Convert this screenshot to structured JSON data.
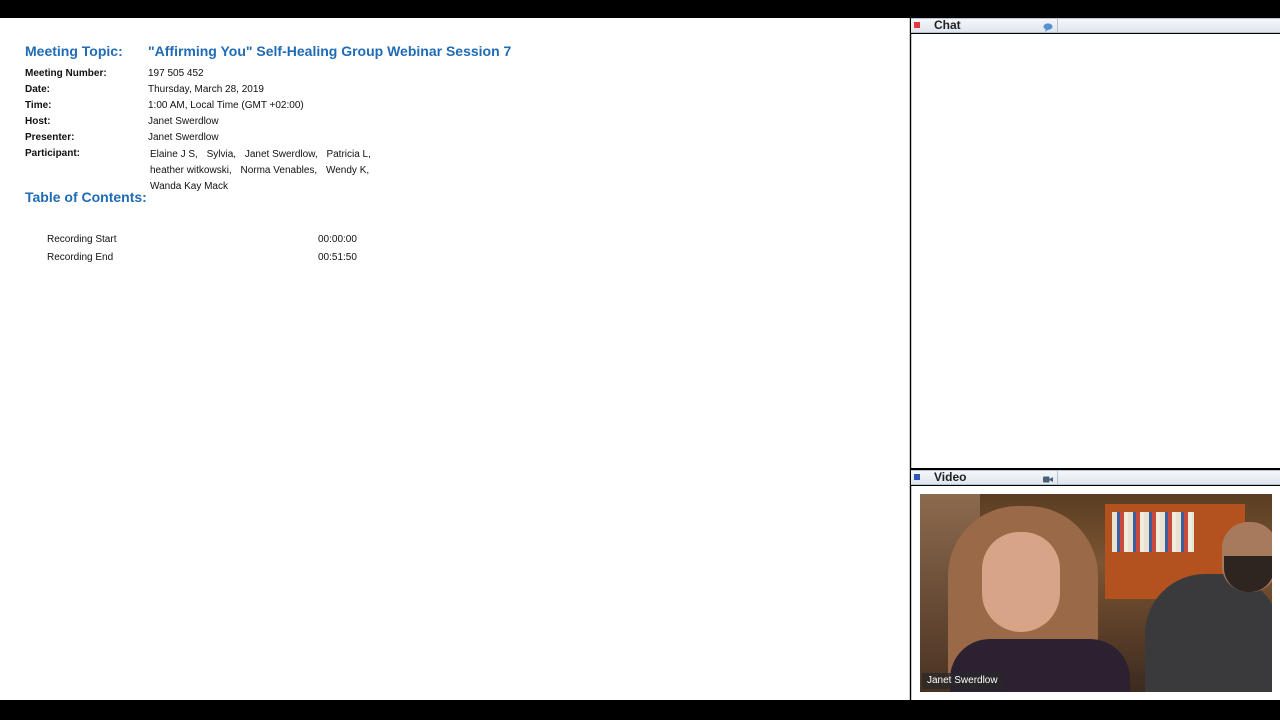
{
  "meeting": {
    "topic_label": "Meeting Topic:",
    "topic": "\"Affirming You\" Self-Healing Group Webinar Session 7",
    "fields": [
      {
        "label": "Meeting Number:",
        "value": "197 505 452"
      },
      {
        "label": "Date:",
        "value": "Thursday, March 28, 2019"
      },
      {
        "label": "Time:",
        "value": "1:00 AM, Local Time (GMT +02:00)"
      },
      {
        "label": "Host:",
        "value": "Janet Swerdlow"
      },
      {
        "label": "Presenter:",
        "value": "Janet Swerdlow"
      }
    ],
    "participant_label": "Participant:",
    "participants": [
      "Elaine J S,",
      "Sylvia,",
      "Janet Swerdlow,",
      "Patricia L,",
      "heather witkowski,",
      "Norma Venables,",
      "Wendy K,",
      "Wanda Kay Mack"
    ]
  },
  "toc": {
    "title": "Table of Contents:",
    "entries": [
      {
        "label": "Recording Start",
        "time": "00:00:00"
      },
      {
        "label": "Recording End",
        "time": "00:51:50"
      }
    ]
  },
  "chat_panel": {
    "title": "Chat",
    "icon": "chat-bubble-icon",
    "status_color": "#e0393e"
  },
  "video_panel": {
    "title": "Video",
    "icon": "video-camera-icon",
    "status_color": "#2e57b8",
    "speaker_name": "Janet Swerdlow"
  },
  "colors": {
    "heading": "#1f6bb5"
  }
}
